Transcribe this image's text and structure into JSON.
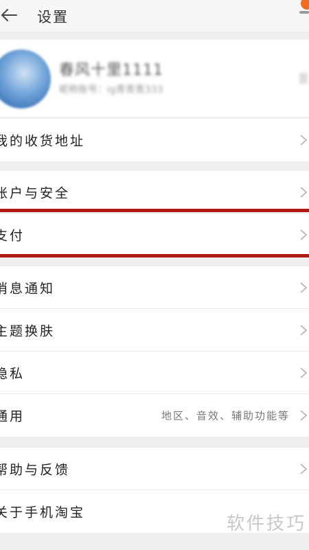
{
  "header": {
    "title": "设置",
    "back_icon": "arrow-left-icon"
  },
  "profile": {
    "username": "春风十里1111",
    "subinfo": "昵称账号：ig青青青333"
  },
  "sections": {
    "address": [
      {
        "label": "我的收货地址"
      }
    ],
    "security": [
      {
        "label": "账户与安全"
      },
      {
        "label": "支付"
      }
    ],
    "settings": [
      {
        "label": "消息通知"
      },
      {
        "label": "主题换肤"
      },
      {
        "label": "隐私"
      },
      {
        "label": "通用",
        "value": "地区、音效、辅助功能等"
      }
    ],
    "about": [
      {
        "label": "帮助与反馈"
      },
      {
        "label": "关于手机淘宝"
      }
    ]
  },
  "watermark": "软件技巧",
  "colors": {
    "highlight_line": "#b01a12",
    "accent_dot": "#f36d21",
    "background": "#efefef"
  }
}
